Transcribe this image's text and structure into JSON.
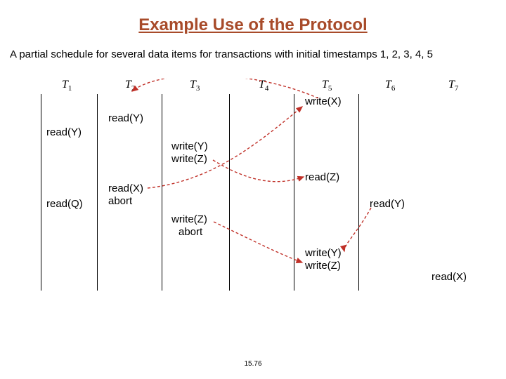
{
  "title": "Example Use of the Protocol",
  "intro": "A partial schedule for several data items for transactions with initial timestamps 1, 2, 3, 4, 5",
  "columns": [
    "T",
    "T",
    "T",
    "T",
    "T",
    "T",
    "T"
  ],
  "subscripts": [
    "1",
    "2",
    "3",
    "4",
    "5",
    "6",
    "7"
  ],
  "ops": {
    "c1_readY": "read(Y)",
    "c1_readQ": "read(Q)",
    "c2_readY": "read(Y)",
    "c2_readX": "read(X)",
    "c2_abort": "abort",
    "c3_writeYZ_a": "write(Y)",
    "c3_writeYZ_b": "write(Z)",
    "c3_writeZ": "write(Z)",
    "c3_abort": "abort",
    "c5_writeX": "write(X)",
    "c5_readZ": "read(Z)",
    "c5_writeY": "write(Y)",
    "c5_writeZ": "write(Z)",
    "c6_readY": "read(Y)",
    "c7_readX": "read(X)"
  },
  "footer": "15.76"
}
